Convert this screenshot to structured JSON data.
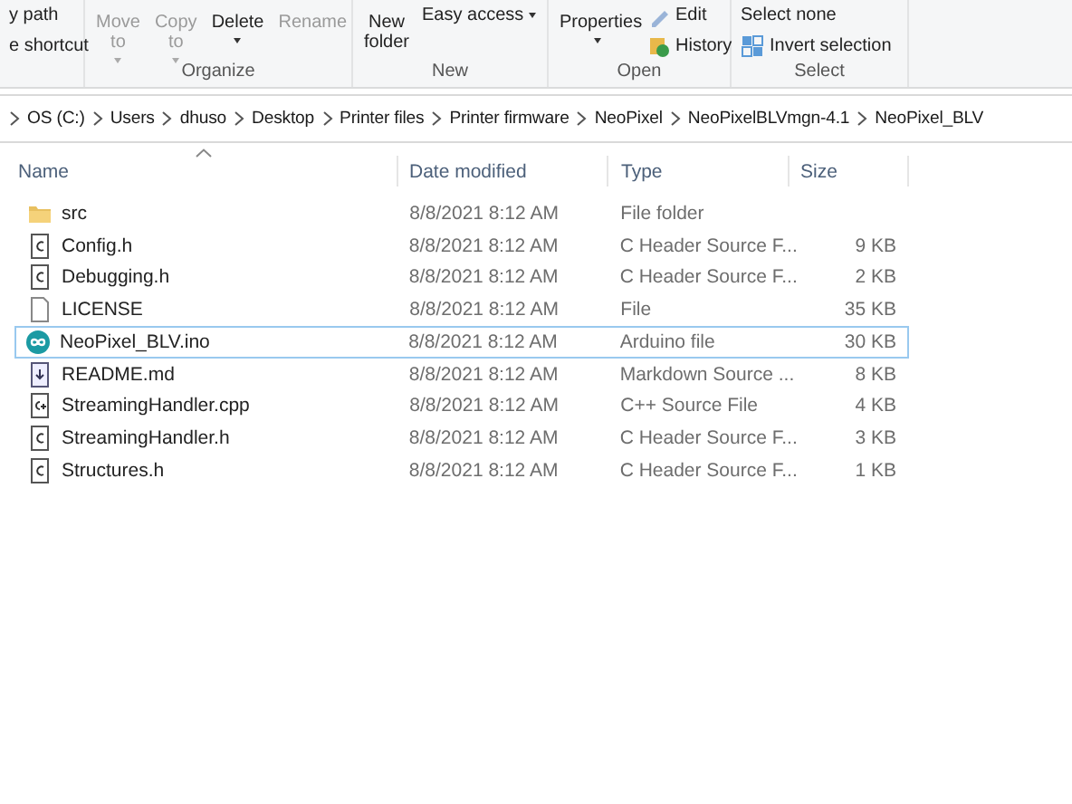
{
  "ribbon": {
    "groups": [
      {
        "items": [
          {
            "kind": "small",
            "label": "y path",
            "disabled": false,
            "dropdown": false
          },
          {
            "kind": "small",
            "label": "e shortcut",
            "disabled": false,
            "dropdown": false
          }
        ]
      },
      {
        "label": "Organize",
        "items": [
          {
            "kind": "large",
            "label": "Move to",
            "disabled": true,
            "dropdown": true
          },
          {
            "kind": "large",
            "label": "Copy to",
            "disabled": true,
            "dropdown": true
          },
          {
            "kind": "large",
            "label": "Delete",
            "disabled": false,
            "dropdown": true
          },
          {
            "kind": "large",
            "label": "Rename",
            "disabled": true,
            "dropdown": false
          }
        ]
      },
      {
        "label": "New",
        "items": [
          {
            "kind": "large",
            "label": "New folder",
            "disabled": false,
            "dropdown": false
          },
          {
            "kind": "small",
            "label": "Easy access",
            "disabled": false,
            "dropdown": true
          }
        ]
      },
      {
        "label": "Open",
        "items": [
          {
            "kind": "large",
            "label": "Properties",
            "disabled": false,
            "dropdown": true
          },
          {
            "kind": "small",
            "label": "Edit",
            "disabled": false,
            "dropdown": false
          },
          {
            "kind": "small",
            "label": "History",
            "disabled": false,
            "dropdown": false
          }
        ]
      },
      {
        "label": "Select",
        "items": [
          {
            "kind": "small",
            "label": "Select none",
            "disabled": false,
            "dropdown": false
          },
          {
            "kind": "small",
            "label": "Invert selection",
            "disabled": false,
            "dropdown": false
          }
        ]
      }
    ]
  },
  "breadcrumb": [
    "OS (C:)",
    "Users",
    "dhuso",
    "Desktop",
    "Printer files",
    "Printer firmware",
    "NeoPixel",
    "NeoPixelBLVmgn-4.1",
    "NeoPixel_BLV"
  ],
  "table": {
    "columns": [
      "Name",
      "Date modified",
      "Type",
      "Size"
    ],
    "rows": [
      {
        "kind": "folder",
        "name": "src",
        "date": "8/8/2021 8:12 AM",
        "type": "File folder",
        "size": "",
        "selected": false
      },
      {
        "kind": "c",
        "name": "Config.h",
        "date": "8/8/2021 8:12 AM",
        "type": "C Header Source F...",
        "size": "9 KB",
        "selected": false
      },
      {
        "kind": "c",
        "name": "Debugging.h",
        "date": "8/8/2021 8:12 AM",
        "type": "C Header Source F...",
        "size": "2 KB",
        "selected": false
      },
      {
        "kind": "file",
        "name": "LICENSE",
        "date": "8/8/2021 8:12 AM",
        "type": "File",
        "size": "35 KB",
        "selected": false
      },
      {
        "kind": "arduino",
        "name": "NeoPixel_BLV.ino",
        "date": "8/8/2021 8:12 AM",
        "type": "Arduino file",
        "size": "30 KB",
        "selected": true
      },
      {
        "kind": "markdown",
        "name": "README.md",
        "date": "8/8/2021 8:12 AM",
        "type": "Markdown Source ...",
        "size": "8 KB",
        "selected": false
      },
      {
        "kind": "cpp",
        "name": "StreamingHandler.cpp",
        "date": "8/8/2021 8:12 AM",
        "type": "C++ Source File",
        "size": "4 KB",
        "selected": false
      },
      {
        "kind": "c",
        "name": "StreamingHandler.h",
        "date": "8/8/2021 8:12 AM",
        "type": "C Header Source F...",
        "size": "3 KB",
        "selected": false
      },
      {
        "kind": "c",
        "name": "Structures.h",
        "date": "8/8/2021 8:12 AM",
        "type": "C Header Source F...",
        "size": "1 KB",
        "selected": false
      }
    ]
  }
}
